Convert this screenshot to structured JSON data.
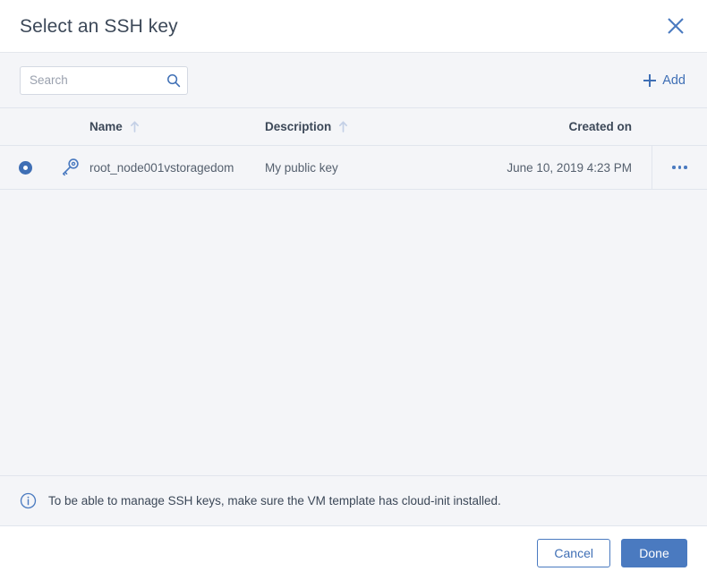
{
  "dialog": {
    "title": "Select an SSH key",
    "close_icon": "close-icon"
  },
  "toolbar": {
    "search_placeholder": "Search",
    "search_value": "",
    "search_icon": "search-icon",
    "add_label": "Add",
    "add_icon": "plus-icon"
  },
  "table": {
    "columns": [
      {
        "key": "name",
        "label": "Name",
        "sort_icon": "sort-ascending-arrow-icon",
        "sorted": true
      },
      {
        "key": "description",
        "label": "Description",
        "sort_icon": "sort-ascending-arrow-icon",
        "sorted": true
      },
      {
        "key": "created_on",
        "label": "Created on",
        "sort_icon": "",
        "sorted": false
      }
    ],
    "rows": [
      {
        "selected": true,
        "row_icon": "key-icon",
        "name": "root_node001vstoragedom",
        "description": "My public key",
        "created_on": "June 10, 2019 4:23 PM",
        "menu_icon": "kebab-menu-icon"
      }
    ]
  },
  "info": {
    "icon": "info-circle-icon",
    "message": "To be able to manage SSH keys, make sure the VM template has cloud-init installed."
  },
  "footer": {
    "cancel_label": "Cancel",
    "done_label": "Done"
  },
  "colors": {
    "accent": "#4a7ac0",
    "link": "#3f6fb5",
    "text": "#3c4858",
    "muted_text": "#55606e",
    "panel_bg": "#f4f5f8",
    "border": "#e1e5ed",
    "white": "#ffffff"
  }
}
